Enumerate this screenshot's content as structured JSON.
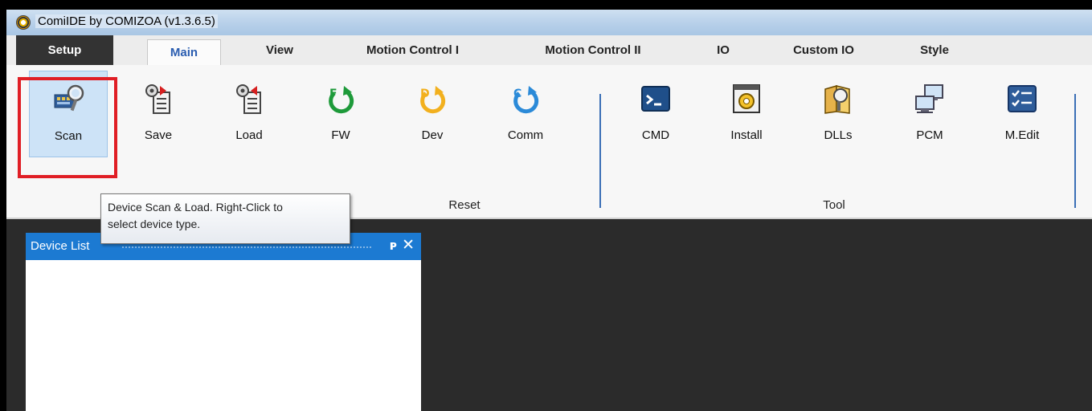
{
  "window": {
    "title": "ComiIDE by COMIZOA (v1.3.6.5)"
  },
  "tabs": [
    {
      "label": "Setup"
    },
    {
      "label": "Main"
    },
    {
      "label": "View"
    },
    {
      "label": "Motion Control I"
    },
    {
      "label": "Motion Control II"
    },
    {
      "label": "IO"
    },
    {
      "label": "Custom IO"
    },
    {
      "label": "Style"
    }
  ],
  "ribbon": {
    "buttons": [
      {
        "label": "Scan",
        "icon": "scan-card-icon"
      },
      {
        "label": "Save",
        "icon": "gear-document-save-icon"
      },
      {
        "label": "Load",
        "icon": "gear-document-load-icon"
      },
      {
        "label": "FW",
        "icon": "reset-fw-icon"
      },
      {
        "label": "Dev",
        "icon": "reset-dev-icon"
      },
      {
        "label": "Comm",
        "icon": "reset-comm-icon"
      },
      {
        "label": "CMD",
        "icon": "command-prompt-icon"
      },
      {
        "label": "Install",
        "icon": "install-gear-icon"
      },
      {
        "label": "DLLs",
        "icon": "dll-library-icon"
      },
      {
        "label": "PCM",
        "icon": "network-computers-icon"
      },
      {
        "label": "M.Edit",
        "icon": "checklist-edit-icon"
      }
    ],
    "groups": {
      "reset": "Reset",
      "tool": "Tool"
    }
  },
  "tooltip": {
    "line1": "Device Scan & Load. Right-Click to",
    "line2": "select device type."
  },
  "device_list": {
    "title": "Device List",
    "pin": "ᴩ",
    "close": "✕"
  },
  "colors": {
    "accent": "#1c7ad2",
    "highlight": "#e01e25",
    "tab_active_text": "#2a5db0"
  }
}
